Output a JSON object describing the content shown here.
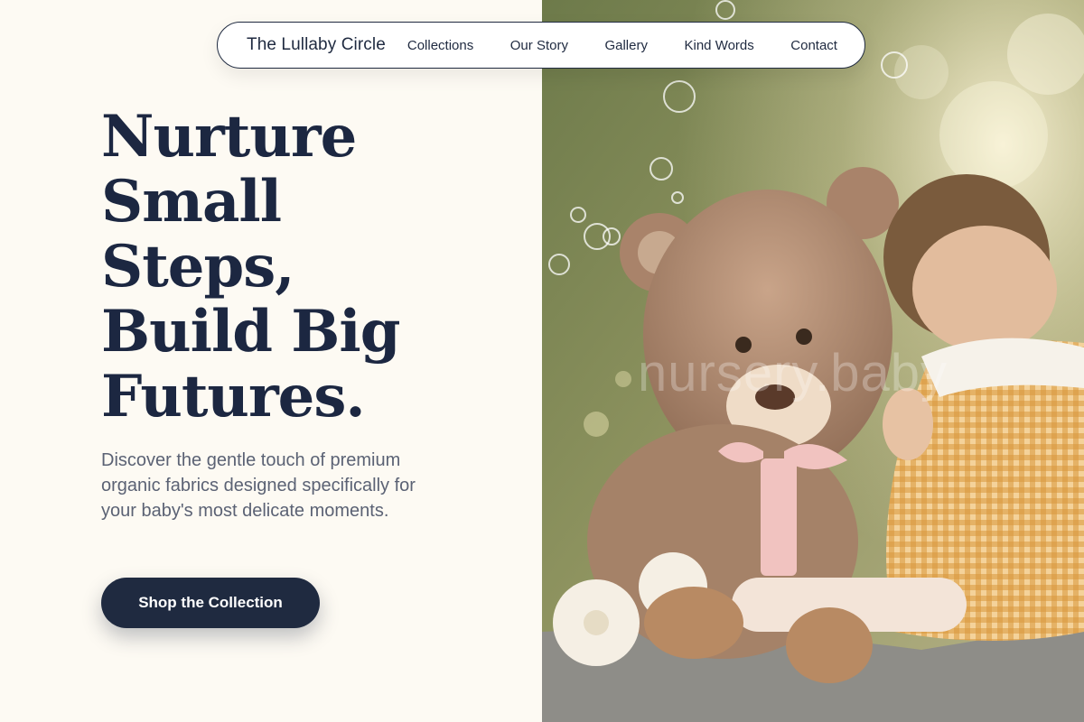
{
  "nav": {
    "brand": "The Lullaby Circle",
    "links": [
      {
        "label": "Collections"
      },
      {
        "label": "Our Story"
      },
      {
        "label": "Gallery"
      },
      {
        "label": "Kind Words"
      },
      {
        "label": "Contact"
      }
    ]
  },
  "hero": {
    "headline_lines": [
      "Nurture",
      "Small",
      "Steps,",
      "Build Big",
      "Futures."
    ],
    "subtext": "Discover the gentle touch of premium organic fabrics designed specifically for your baby's most delicate moments.",
    "cta_label": "Shop the Collection"
  },
  "photo": {
    "watermark": "nursery.baby"
  },
  "colors": {
    "background": "#fdfaf3",
    "navy": "#1f2a40",
    "muted_text": "#5b6274"
  }
}
